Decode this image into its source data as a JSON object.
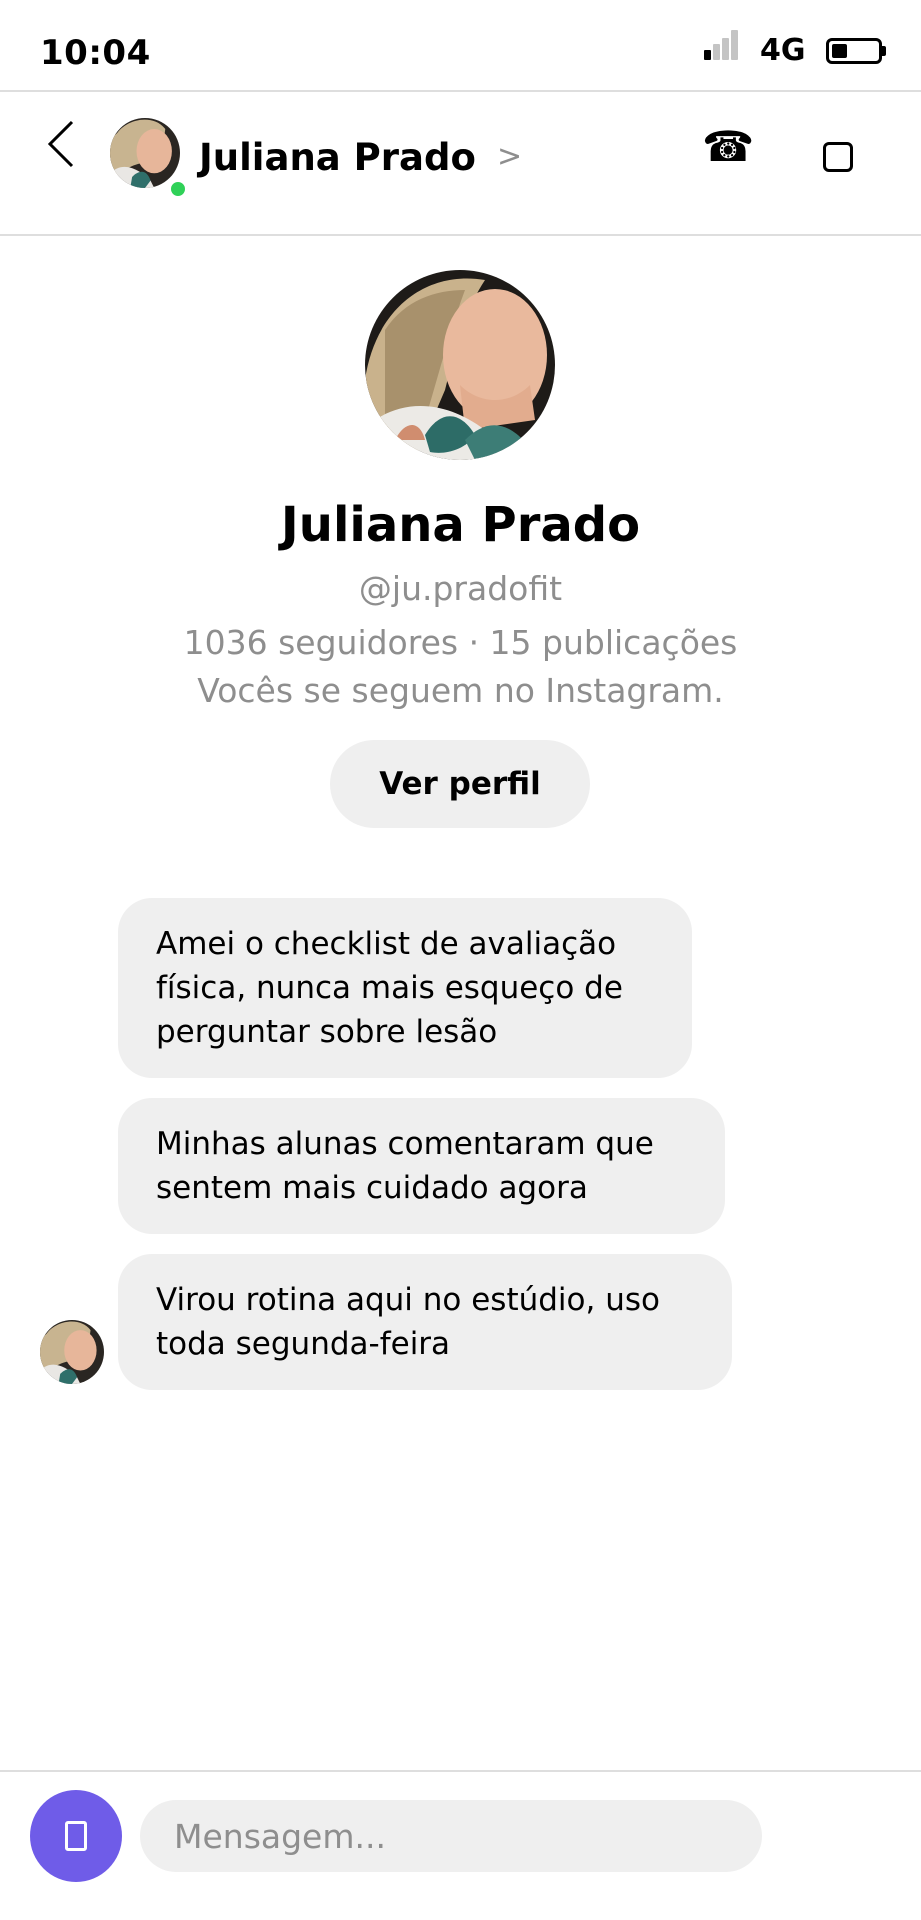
{
  "status_bar": {
    "time": "10:04",
    "network": "4G",
    "battery_level": 0.35,
    "signal_bars": 1
  },
  "header": {
    "contact_name": "Juliana Prado",
    "chevron": ">",
    "call_icon": "☎",
    "online": true
  },
  "profile": {
    "name": "Juliana Prado",
    "handle": "@ju.pradofit",
    "stats": "1036 seguidores · 15 publicações",
    "follow_note": "Vocês se seguem no Instagram.",
    "view_profile_label": "Ver perfil"
  },
  "messages": [
    {
      "text": "Amei o checklist de avaliação física, nunca mais esqueço de perguntar sobre lesão"
    },
    {
      "text": "Minhas alunas comentaram que sentem mais cuidado agora"
    },
    {
      "text": "Virou rotina aqui no estúdio, uso toda segunda-feira"
    }
  ],
  "composer": {
    "placeholder": "Mensagem..."
  },
  "colors": {
    "accent": "#6f5ce8",
    "online": "#2fd158",
    "bubble": "#efefef",
    "muted_text": "#8e8e8e"
  },
  "icons": {
    "back": "chevron-left-icon",
    "call": "phone-icon",
    "video": "video-icon",
    "camera": "camera-icon"
  }
}
